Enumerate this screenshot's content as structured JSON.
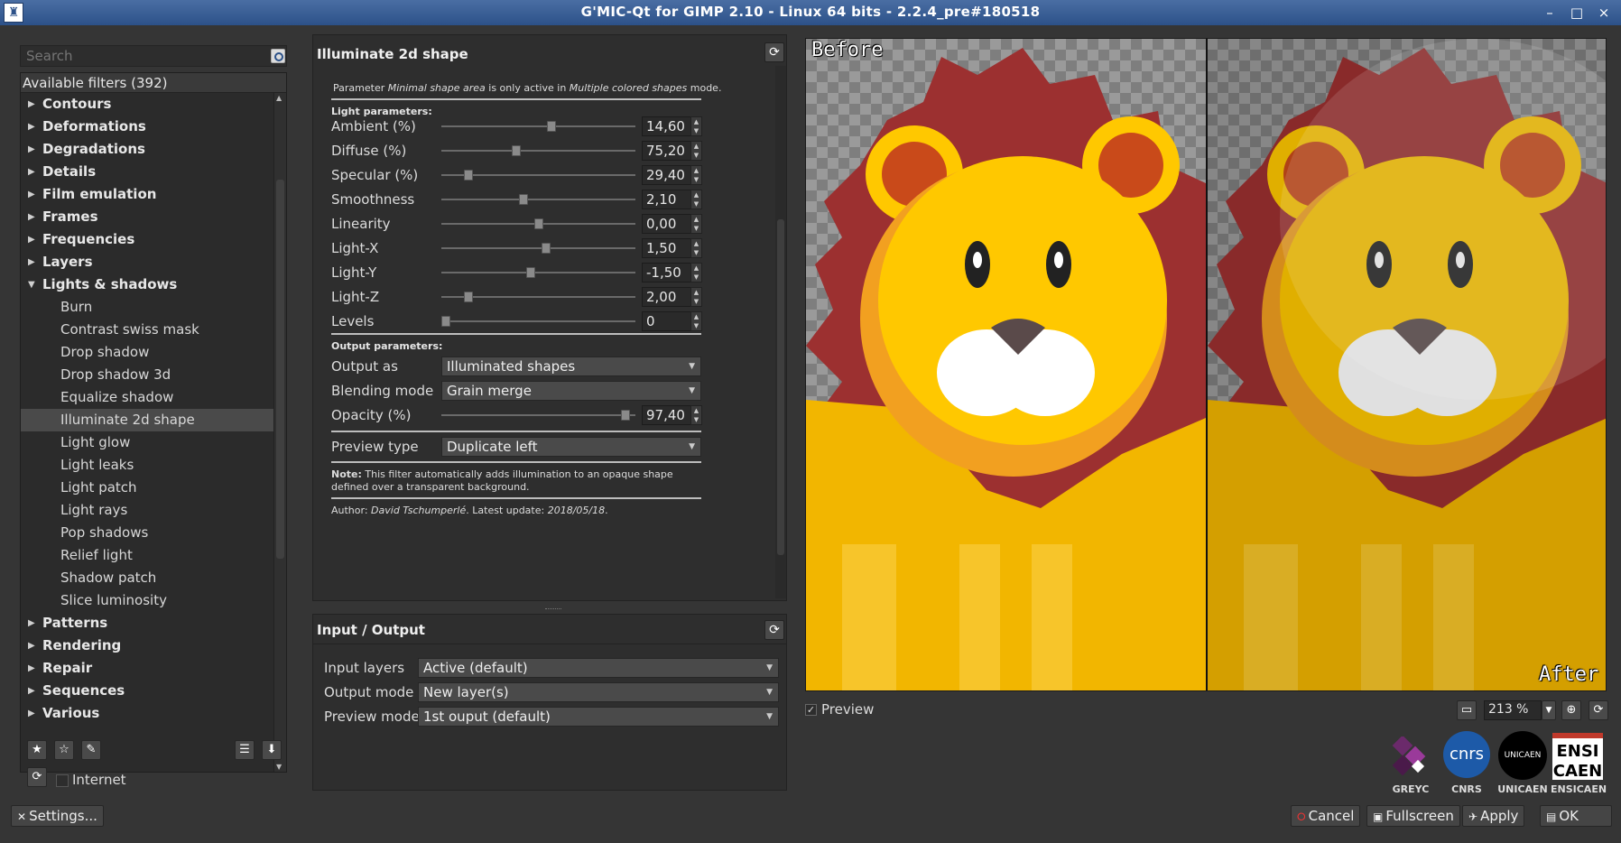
{
  "window": {
    "title": "G'MIC-Qt for GIMP 2.10 - Linux 64 bits - 2.2.4_pre#180518",
    "controls": [
      "–",
      "□",
      "×"
    ]
  },
  "sidebar": {
    "search_placeholder": "Search",
    "header": "Available filters (392)",
    "categories_before": [
      "Contours",
      "Deformations",
      "Degradations",
      "Details",
      "Film emulation",
      "Frames",
      "Frequencies",
      "Layers"
    ],
    "open_category": "Lights & shadows",
    "open_items": [
      "Burn",
      "Contrast swiss mask",
      "Drop shadow",
      "Drop shadow 3d",
      "Equalize shadow",
      "Illuminate 2d shape",
      "Light glow",
      "Light leaks",
      "Light patch",
      "Light rays",
      "Pop shadows",
      "Relief light",
      "Shadow patch",
      "Slice luminosity"
    ],
    "selected_item": "Illuminate 2d shape",
    "categories_after": [
      "Patterns",
      "Rendering",
      "Repair",
      "Sequences",
      "Various"
    ],
    "internet_label": "Internet"
  },
  "params": {
    "title": "Illuminate 2d shape",
    "note_top_pre": "Parameter ",
    "note_top_em1": "Minimal shape area",
    "note_top_mid": " is only active in ",
    "note_top_em2": "Multiple colored shapes",
    "note_top_post": " mode.",
    "light_header": "Light parameters:",
    "sliders": [
      {
        "label": "Ambient (%)",
        "value": "14,60",
        "position": 0.57
      },
      {
        "label": "Diffuse (%)",
        "value": "75,20",
        "position": 0.38
      },
      {
        "label": "Specular (%)",
        "value": "29,40",
        "position": 0.12
      },
      {
        "label": "Smoothness",
        "value": "2,10",
        "position": 0.42
      },
      {
        "label": "Linearity",
        "value": "0,00",
        "position": 0.5
      },
      {
        "label": "Light-X",
        "value": "1,50",
        "position": 0.54
      },
      {
        "label": "Light-Y",
        "value": "-1,50",
        "position": 0.46
      },
      {
        "label": "Light-Z",
        "value": "2,00",
        "position": 0.12
      },
      {
        "label": "Levels",
        "value": "0",
        "position": 0.0
      }
    ],
    "output_header": "Output parameters:",
    "output_as_label": "Output as",
    "output_as_value": "Illuminated shapes",
    "blending_label": "Blending mode",
    "blending_value": "Grain merge",
    "opacity_label": "Opacity (%)",
    "opacity_value": "97,40",
    "opacity_position": 0.97,
    "preview_type_label": "Preview type",
    "preview_type_value": "Duplicate left",
    "note_bold": "Note:",
    "note_text": " This filter automatically adds illumination to an opaque shape defined over a transparent background.",
    "author_pre": "Author: ",
    "author_name": "David Tschumperlé",
    "author_mid": ". Latest update: ",
    "author_date": "2018/05/18",
    "author_post": "."
  },
  "io": {
    "title": "Input / Output",
    "input_layers_label": "Input layers",
    "input_layers_value": "Active (default)",
    "output_mode_label": "Output mode",
    "output_mode_value": "New layer(s)",
    "preview_mode_label": "Preview mode",
    "preview_mode_value": "1st ouput (default)"
  },
  "preview": {
    "before_caption": "Before",
    "after_caption": "After",
    "preview_label": "Preview",
    "zoom": "213 %"
  },
  "logos": [
    "GREYC",
    "CNRS",
    "UNICAEN",
    "ENSICAEN"
  ],
  "logo_texts": {
    "cnrs": "cnrs",
    "unicaen": "UNICAEN",
    "ensi": "ENSI",
    "caen": "CAEN"
  },
  "buttons": {
    "settings": "Settings...",
    "cancel": "Cancel",
    "fullscreen": "Fullscreen",
    "apply": "Apply",
    "ok": "OK"
  },
  "colors": {
    "accent": "#2c5189",
    "mane": "#9c3030",
    "lion_yellow": "#f2b600",
    "face_yellow": "#ffc800"
  }
}
